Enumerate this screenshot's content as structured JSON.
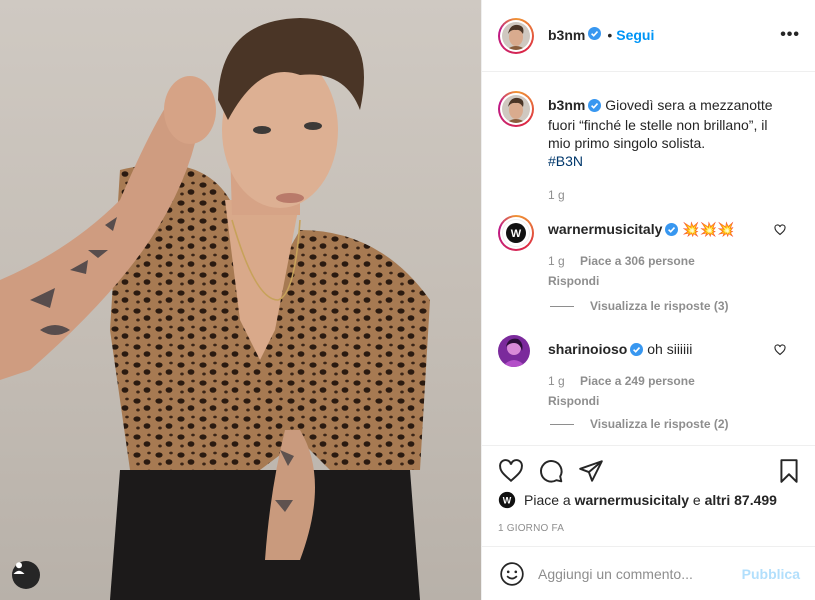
{
  "post": {
    "author": "b3nm",
    "follow_dot": "•",
    "follow_label": "Segui",
    "more_label": "•••"
  },
  "caption": {
    "author": "b3nm",
    "text": "Giovedì sera a mezzanotte fuori “finché le stelle non brillano”, il mio primo singolo solista.",
    "hashtag": "#B3N",
    "time": "1 g"
  },
  "comments": [
    {
      "author": "warnermusicitaly",
      "text": "💥💥💥",
      "time": "1 g",
      "likes": "Piace a 306 persone",
      "reply_label": "Rispondi",
      "view_replies": "Visualizza le risposte (3)"
    },
    {
      "author": "sharinoioso",
      "text": "oh siiiiii",
      "time": "1 g",
      "likes": "Piace a 249 persone",
      "reply_label": "Rispondi",
      "view_replies": "Visualizza le risposte (2)"
    }
  ],
  "likes_summary": {
    "prefix": "Piace a",
    "user": "warnermusicitaly",
    "connector": "e",
    "others": "altri 87.499"
  },
  "date": "1 GIORNO FA",
  "add_comment": {
    "placeholder": "Aggiungi un commento...",
    "publish_label": "Pubblica"
  },
  "icons": {
    "verified": "verified-badge-icon",
    "heart": "heart-icon",
    "comment": "comment-icon",
    "share": "share-icon",
    "save": "bookmark-icon",
    "emoji": "emoji-icon",
    "user_tag": "user-tag-icon"
  },
  "colors": {
    "accent": "#0095f6",
    "verified": "#3897f0",
    "muted": "#8e8e8e",
    "publish_disabled": "#b2dffc"
  }
}
